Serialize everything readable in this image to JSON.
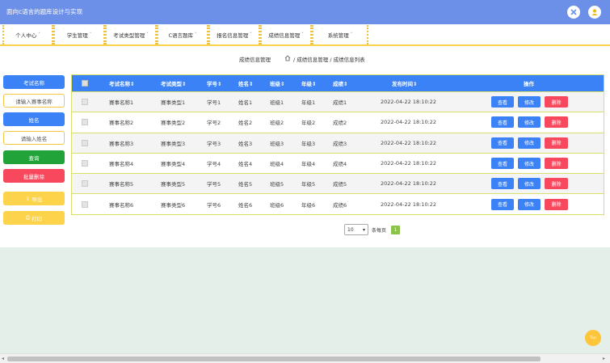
{
  "app": {
    "title": "面向c语言的题库设计与实现"
  },
  "nav": {
    "items": [
      {
        "label": "个人中心"
      },
      {
        "label": "学生管理"
      },
      {
        "label": "考试类型管理"
      },
      {
        "label": "C语言题库"
      },
      {
        "label": "报名信息管理"
      },
      {
        "label": "成绩信息管理"
      },
      {
        "label": "系统管理"
      }
    ],
    "caret": "˅"
  },
  "breadcrumb": {
    "section": "成绩信息管理",
    "path": "/ 成绩信息管理 / 成绩信息列表",
    "home_icon": "home-icon"
  },
  "sidebar": {
    "exam_name_label": "考试名称",
    "exam_name_placeholder": "请输入赛事名称",
    "name_label": "姓名",
    "name_placeholder": "请输入姓名",
    "query": "查询",
    "batch_delete": "批量删除",
    "export": "导出",
    "print": "打印"
  },
  "table": {
    "headers": [
      "考试名称",
      "考试类型",
      "学号",
      "姓名",
      "班级",
      "年级",
      "成绩",
      "发布时间",
      "操作"
    ],
    "sort_icon": "⇕",
    "rows": [
      [
        "赛事名称1",
        "赛事类型1",
        "学号1",
        "姓名1",
        "班级1",
        "年级1",
        "成绩1",
        "2022-04-22 18:10:22"
      ],
      [
        "赛事名称2",
        "赛事类型2",
        "学号2",
        "姓名2",
        "班级2",
        "年级2",
        "成绩2",
        "2022-04-22 18:10:22"
      ],
      [
        "赛事名称3",
        "赛事类型3",
        "学号3",
        "姓名3",
        "班级3",
        "年级3",
        "成绩3",
        "2022-04-22 18:10:22"
      ],
      [
        "赛事名称4",
        "赛事类型4",
        "学号4",
        "姓名4",
        "班级4",
        "年级4",
        "成绩4",
        "2022-04-22 18:10:22"
      ],
      [
        "赛事名称5",
        "赛事类型5",
        "学号5",
        "姓名5",
        "班级5",
        "年级5",
        "成绩5",
        "2022-04-22 18:10:22"
      ],
      [
        "赛事名称6",
        "赛事类型6",
        "学号6",
        "姓名6",
        "班级6",
        "年级6",
        "成绩6",
        "2022-04-22 18:10:22"
      ]
    ],
    "actions": {
      "view": "查看",
      "edit": "修改",
      "delete": "删除"
    }
  },
  "pager": {
    "page_size": "10",
    "per_page_label": "条每页",
    "current_page": "1"
  },
  "scroll_top": {
    "label": "Top"
  },
  "colors": {
    "topbar": "#6c8fe8",
    "primary": "#3b82f6",
    "danger": "#f8485e",
    "success": "#22a33a",
    "warning": "#fdd34b"
  }
}
